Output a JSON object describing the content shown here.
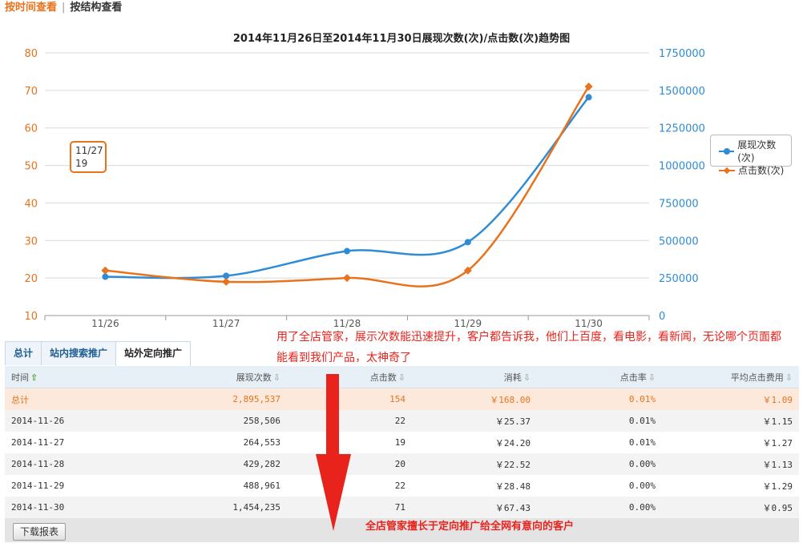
{
  "nav": {
    "by_time": "按时间查看",
    "separator": "|",
    "by_structure": "按结构查看"
  },
  "chart_data": {
    "type": "line",
    "title": "2014年11月26日至2014年11月30日展现次数(次)/点击数(次)趋势图",
    "categories": [
      "11/26",
      "11/27",
      "11/28",
      "11/29",
      "11/30"
    ],
    "series": [
      {
        "name": "展现次数(次)",
        "axis": "right",
        "color": "#2e8bd6",
        "marker": "circle",
        "values": [
          258506,
          264553,
          429282,
          488961,
          1454235
        ]
      },
      {
        "name": "点击数(次)",
        "axis": "left",
        "color": "#e8731c",
        "marker": "diamond",
        "values": [
          22,
          19,
          20,
          22,
          71
        ]
      }
    ],
    "left_axis": {
      "min": 10,
      "max": 80,
      "ticks": [
        "10",
        "20",
        "30",
        "40",
        "50",
        "60",
        "70",
        "80"
      ],
      "color": "#e8731c"
    },
    "right_axis": {
      "min": 0,
      "max": 1750000,
      "ticks": [
        "0",
        "250000",
        "500000",
        "750000",
        "1000000",
        "1250000",
        "1500000",
        "1750000"
      ],
      "color": "#2e8bd6"
    },
    "legend": "right",
    "grid": true,
    "tooltip": {
      "date": "11/27",
      "value": "19"
    }
  },
  "annotations": {
    "top": "用了全店管家，展示次数能迅速提升，客户都告诉我，他们上百度，看电影，看新闻，无论哪个页面都能看到我们产品，太神奇了",
    "bottom": "全店管家擅长于定向推广给全网有意向的客户"
  },
  "tabs": [
    "总计",
    "站内搜索推广",
    "站外定向推广"
  ],
  "table": {
    "headers": [
      "时间",
      "展现次数",
      "点击数",
      "消耗",
      "点击率",
      "平均点击费用"
    ],
    "total": [
      "总计",
      "2,895,537",
      "154",
      "￥168.00",
      "0.01%",
      "￥1.09"
    ],
    "rows": [
      [
        "2014-11-26",
        "258,506",
        "22",
        "￥25.37",
        "0.01%",
        "￥1.15"
      ],
      [
        "2014-11-27",
        "264,553",
        "19",
        "￥24.20",
        "0.01%",
        "￥1.27"
      ],
      [
        "2014-11-28",
        "429,282",
        "20",
        "￥22.52",
        "0.00%",
        "￥1.13"
      ],
      [
        "2014-11-29",
        "488,961",
        "22",
        "￥28.48",
        "0.00%",
        "￥1.29"
      ],
      [
        "2014-11-30",
        "1,454,235",
        "71",
        "￥67.43",
        "0.00%",
        "￥0.95"
      ]
    ]
  },
  "download_label": "下载报表",
  "icons": {
    "sort_active": "arrow-up-icon",
    "sort": "sort-down-icon"
  }
}
